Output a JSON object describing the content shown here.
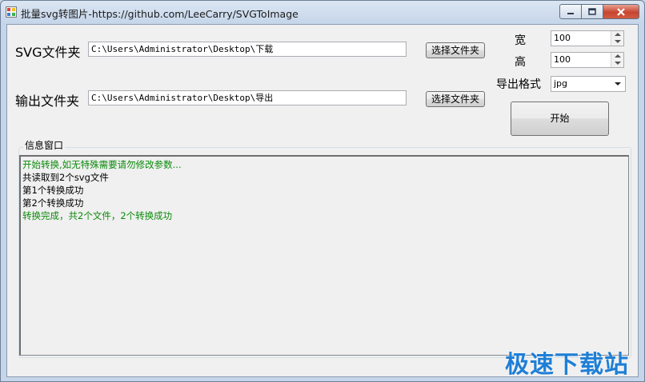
{
  "window": {
    "title": "批量svg转图片-https://github.com/LeeCarry/SVGToImage"
  },
  "form": {
    "svg_folder_label": "SVG文件夹",
    "svg_folder_path": "C:\\Users\\Administrator\\Desktop\\下载",
    "svg_folder_button": "选择文件夹",
    "output_folder_label": "输出文件夹",
    "output_folder_path": "C:\\Users\\Administrator\\Desktop\\导出",
    "output_folder_button": "选择文件夹",
    "width_label": "宽",
    "width_value": "100",
    "height_label": "高",
    "height_value": "100",
    "format_label": "导出格式",
    "format_value": "jpg",
    "start_button": "开始"
  },
  "log": {
    "group_title": "信息窗口",
    "lines": [
      {
        "text": "开始转换,如无特殊需要请勿修改参数...",
        "color": "#0a8a0a"
      },
      {
        "text": "共读取到2个svg文件",
        "color": "#000000"
      },
      {
        "text": "第1个转换成功",
        "color": "#000000"
      },
      {
        "text": "第2个转换成功",
        "color": "#000000"
      },
      {
        "text": "转换完成，共2个文件，2个转换成功",
        "color": "#0a8a0a"
      }
    ]
  },
  "watermark": "极速下载站"
}
